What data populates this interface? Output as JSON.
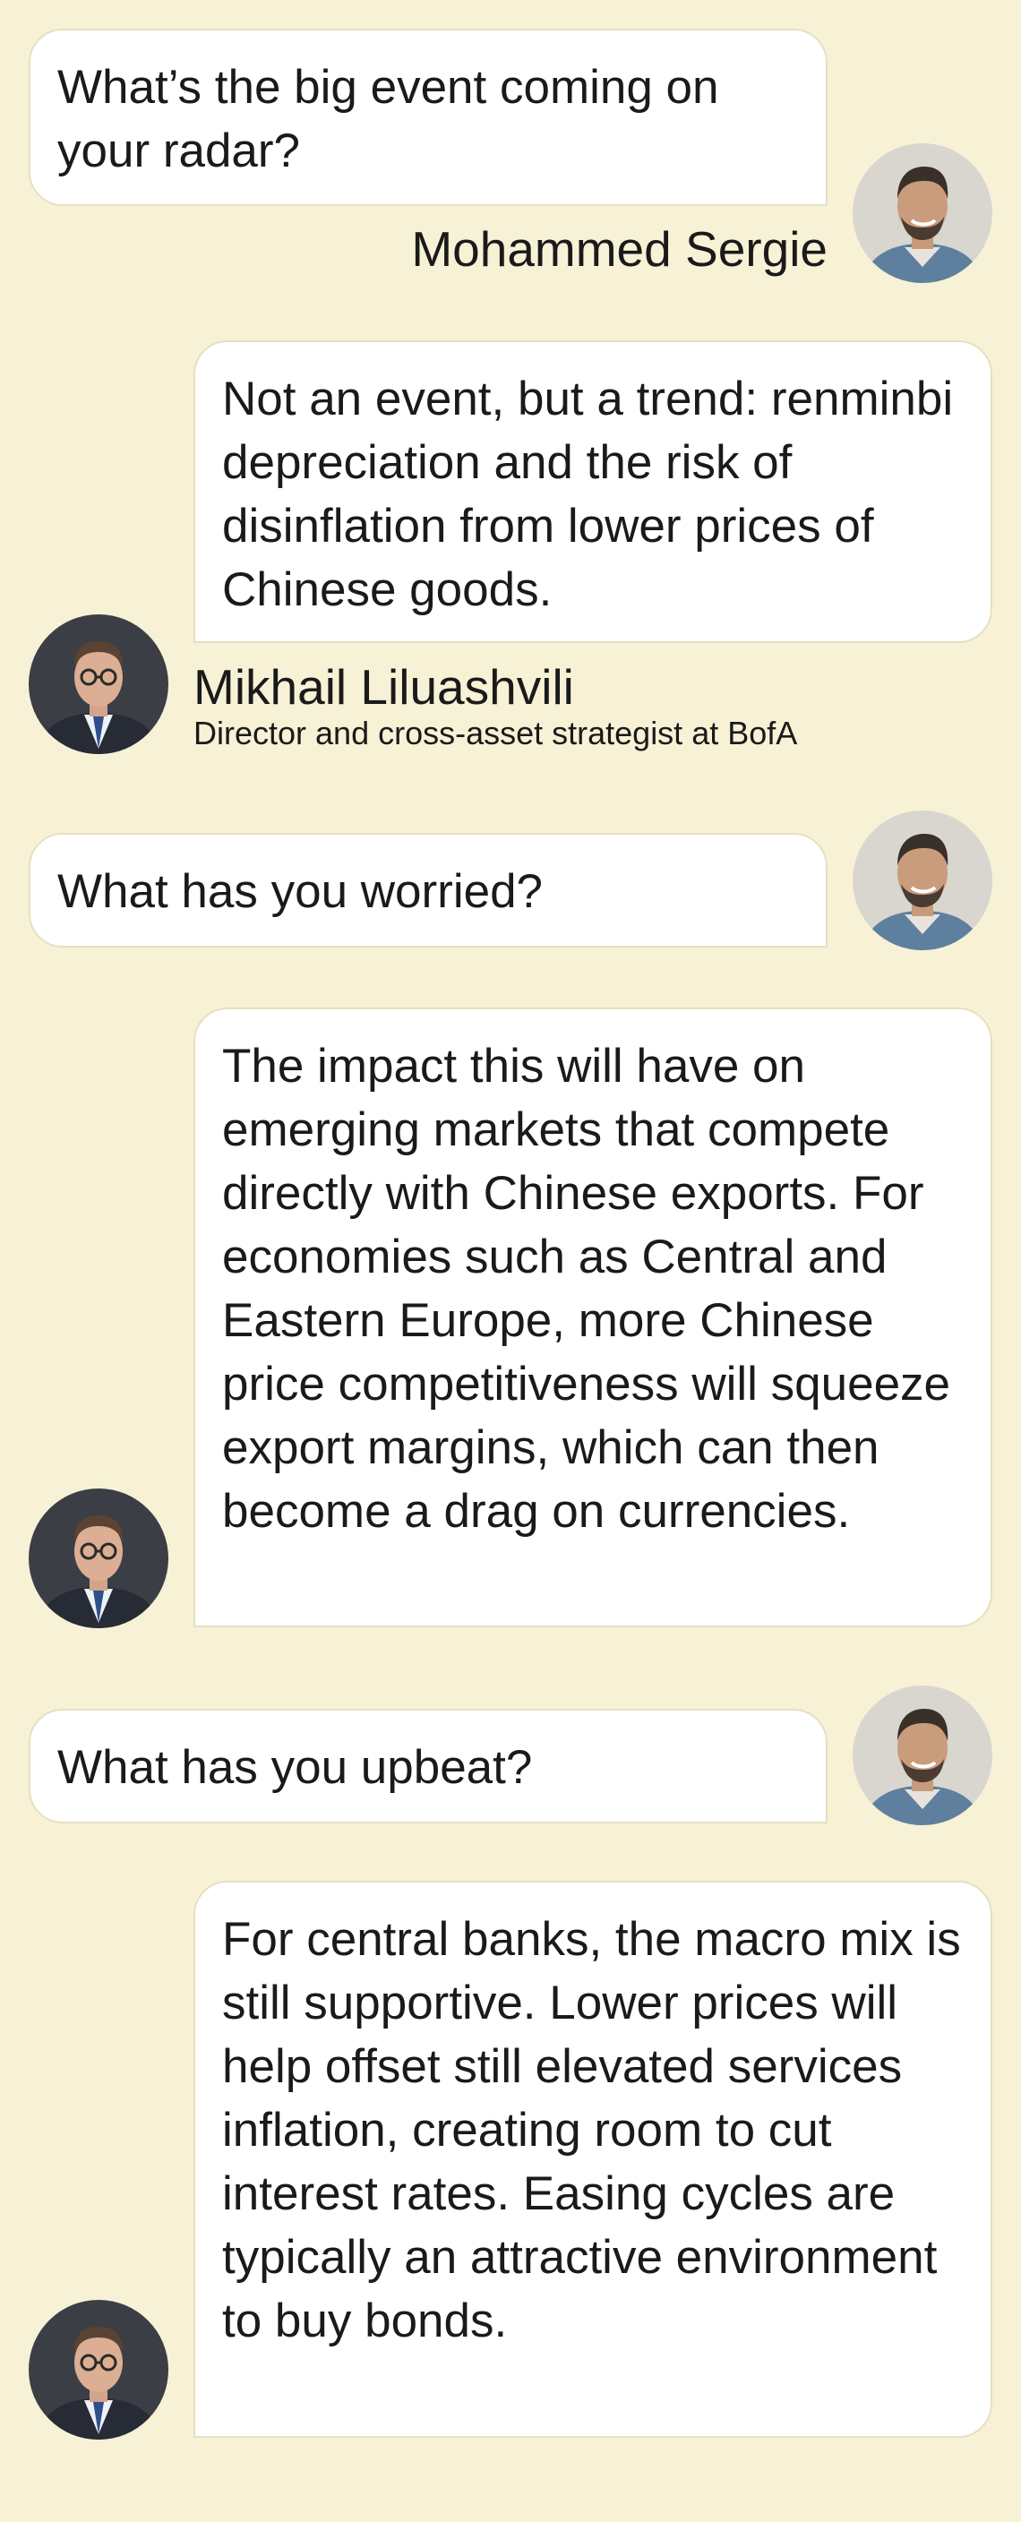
{
  "interviewer": {
    "name": "Mohammed Sergie",
    "avatar_icon": "interviewer-avatar"
  },
  "respondent": {
    "name": "Mikhail Liluashvili",
    "title": "Director and cross-asset strategist at BofA",
    "avatar_icon": "respondent-avatar"
  },
  "colors": {
    "background": "#f7f1d6",
    "bubble": "#ffffff",
    "bubble_border": "#e7dfc2"
  },
  "messages": [
    {
      "speaker": "interviewer",
      "text": "What’s the big event coming on your radar?"
    },
    {
      "speaker": "respondent",
      "text": "Not an event, but a trend: renminbi depreciation and the risk of disinflation from lower prices of Chinese goods."
    },
    {
      "speaker": "interviewer",
      "text": "What has you worried?"
    },
    {
      "speaker": "respondent",
      "text": "The impact this will have on emerging markets that compete directly with Chinese exports. For economies such as Central and Eastern Europe, more Chinese price competitiveness will squeeze export margins, which can then become a drag on currencies."
    },
    {
      "speaker": "interviewer",
      "text": "What has you upbeat?"
    },
    {
      "speaker": "respondent",
      "text": "For central banks, the macro mix is still supportive. Lower prices will help offset still elevated services inflation, creating room to cut interest rates. Easing cycles are typically an attractive environment to buy bonds."
    }
  ]
}
